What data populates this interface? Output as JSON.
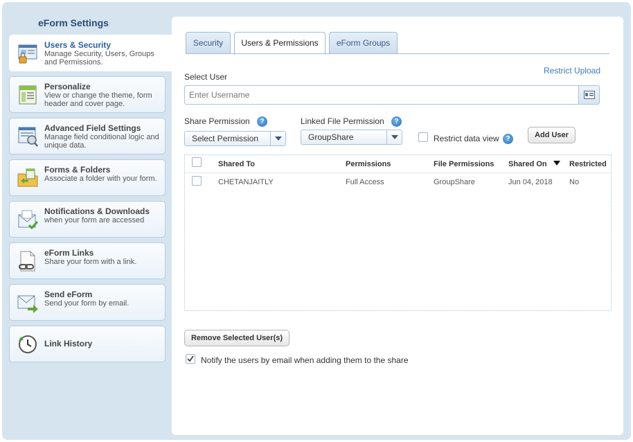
{
  "sidebar": {
    "title": "eForm Settings",
    "items": [
      {
        "label": "Users & Security",
        "desc": "Manage Security, Users, Groups and Permissions.",
        "icon": "users-security-icon",
        "active": true
      },
      {
        "label": "Personalize",
        "desc": "View or change the theme, form header and cover page.",
        "icon": "personalize-icon"
      },
      {
        "label": "Advanced Field Settings",
        "desc": "Manage field conditional logic and unique data.",
        "icon": "advanced-field-settings-icon"
      },
      {
        "label": "Forms & Folders",
        "desc": "Associate a folder with your form.",
        "icon": "forms-folders-icon"
      },
      {
        "label": "Notifications & Downloads",
        "desc": "when your form are accessed",
        "icon": "notifications-envelope-icon"
      },
      {
        "label": "eForm Links",
        "desc": "Share your form with a link.",
        "icon": "eform-links-icon"
      },
      {
        "label": "Send eForm",
        "desc": "Send your form by email.",
        "icon": "send-eform-icon"
      },
      {
        "label": "Link History",
        "desc": "",
        "icon": "link-history-icon"
      }
    ]
  },
  "tabs": [
    {
      "label": "Security"
    },
    {
      "label": "Users & Permissions",
      "active": true
    },
    {
      "label": "eForm Groups"
    }
  ],
  "form": {
    "select_user_label": "Select User",
    "restrict_upload_link": "Restrict Upload",
    "username_placeholder": "Enter Username",
    "share_permission_label": "Share Permission",
    "share_permission_value": "Select Permission",
    "linked_file_permission_label": "Linked File Permission",
    "linked_file_permission_value": "GroupShare",
    "restrict_data_view_label": "Restrict data view",
    "add_user_button": "Add User",
    "help_glyph": "?"
  },
  "table": {
    "columns": [
      "Shared To",
      "Permissions",
      "File Permissions",
      "Shared On",
      "Restricted"
    ],
    "sort_column": "Shared On",
    "rows": [
      [
        "CHETANJAITLY",
        "Full Access",
        "GroupShare",
        "Jun 04, 2018",
        "No"
      ]
    ]
  },
  "actions": {
    "remove_button": "Remove Selected User(s)",
    "notify_label": "Notify the users by email when adding them to the share",
    "notify_checked": true
  },
  "colors": {
    "accent": "#2b5f9e",
    "link": "#3b79c0",
    "sidebar_bg": "#d6e4ef"
  }
}
